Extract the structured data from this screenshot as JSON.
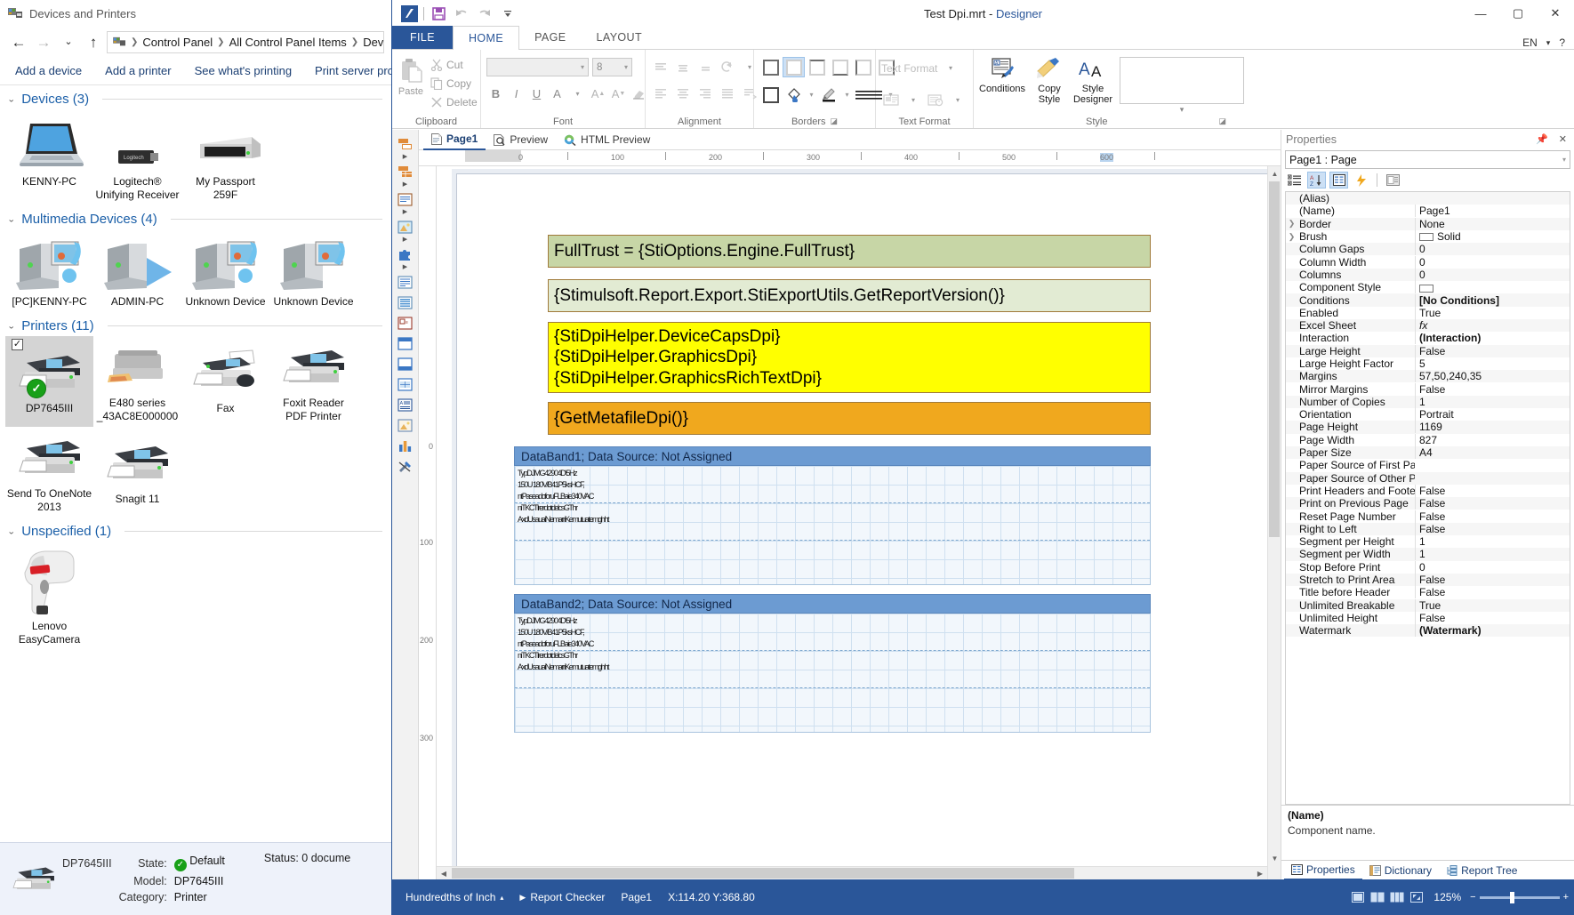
{
  "explorer": {
    "window_title": "Devices and Printers",
    "nav": {
      "back": "back-arrow",
      "forward": "forward-arrow",
      "recent": "chevron-down",
      "up": "up-arrow"
    },
    "breadcrumb": [
      "Control Panel",
      "All Control Panel Items",
      "Devices and Printers"
    ],
    "breadcrumb_visible_last": "Devices an",
    "commands": [
      "Add a device",
      "Add a printer",
      "See what's printing",
      "Print server prope"
    ],
    "groups": [
      {
        "title": "Devices (3)",
        "items": [
          {
            "label": "KENNY-PC",
            "icon": "laptop-icon"
          },
          {
            "label": "Logitech® Unifying Receiver",
            "icon": "usb-receiver-icon"
          },
          {
            "label": "My Passport 259F",
            "icon": "external-drive-icon"
          }
        ]
      },
      {
        "title": "Multimedia Devices (4)",
        "items": [
          {
            "label": "[PC]KENNY-PC",
            "icon": "media-device-icon"
          },
          {
            "label": "ADMIN-PC",
            "icon": "media-player-icon"
          },
          {
            "label": "Unknown Device",
            "icon": "media-device-icon"
          },
          {
            "label": "Unknown Device",
            "icon": "media-device-icon"
          }
        ]
      },
      {
        "title": "Printers (11)",
        "items": [
          {
            "label": "DP7645III",
            "icon": "printer-icon",
            "selected": true,
            "default": true,
            "checked": true
          },
          {
            "label": "E480 series _43AC8E000000",
            "icon": "inkjet-printer-icon"
          },
          {
            "label": "Fax",
            "icon": "fax-icon"
          },
          {
            "label": "Foxit Reader PDF Printer",
            "icon": "printer-icon"
          },
          {
            "label": "Send To OneNote 2013",
            "icon": "printer-icon"
          },
          {
            "label": "Snagit 11",
            "icon": "printer-icon"
          }
        ]
      },
      {
        "title": "Unspecified (1)",
        "items": [
          {
            "label": "Lenovo EasyCamera",
            "icon": "barcode-scanner-icon"
          }
        ]
      }
    ],
    "details": {
      "name": "DP7645III",
      "rows": [
        {
          "key": "State:",
          "value": "Default",
          "badge": "check-badge"
        },
        {
          "key": "Model:",
          "value": "DP7645III"
        },
        {
          "key": "Category:",
          "value": "Printer"
        }
      ],
      "status_key": "Status:",
      "status_value": "0 docume"
    }
  },
  "designer": {
    "title_file": "Test Dpi.mrt",
    "title_sep": "-",
    "title_app": "Designer",
    "quick_access": [
      "app-logo-icon",
      "save-icon",
      "undo-icon",
      "redo-icon",
      "customize-qat-icon"
    ],
    "window_buttons": [
      "minimize",
      "maximize",
      "close"
    ],
    "language": "EN",
    "tabs": [
      {
        "label": "FILE",
        "type": "file"
      },
      {
        "label": "HOME",
        "active": true
      },
      {
        "label": "PAGE"
      },
      {
        "label": "LAYOUT"
      }
    ],
    "ribbon": {
      "clipboard": {
        "label": "Clipboard",
        "paste": "Paste",
        "items": [
          "Cut",
          "Copy",
          "Delete"
        ]
      },
      "font": {
        "label": "Font",
        "font_name": "",
        "font_size": "8",
        "buttons": [
          "B",
          "I",
          "U",
          "A",
          "A-grow",
          "A-shrink",
          "clear-format"
        ]
      },
      "alignment": {
        "label": "Alignment",
        "buttons": [
          "align-top",
          "align-middle",
          "align-bottom",
          "text-rotation",
          "align-left",
          "align-center",
          "align-right",
          "align-justify",
          "text-wrap"
        ]
      },
      "borders": {
        "label": "Borders",
        "presets": [
          "all-borders",
          "no-border",
          "top-border",
          "bottom-border",
          "left-border",
          "right-border",
          "outline-border"
        ],
        "selected_index": 1,
        "fill": "fill-color-icon",
        "pen": "border-color-icon",
        "style": "border-style-icon"
      },
      "text_format": {
        "label": "Text Format",
        "combo_value": "Text Format",
        "buttons": [
          "format-image",
          "format-datetime"
        ]
      },
      "style": {
        "label": "Style",
        "conditions": "Conditions",
        "copy_style": "Copy\nStyle",
        "copy_style_l1": "Copy",
        "copy_style_l2": "Style",
        "style_designer_l1": "Style",
        "style_designer_l2": "Designer"
      }
    },
    "page_tabs": [
      {
        "label": "Page1",
        "icon": "page-icon",
        "active": true
      },
      {
        "label": "Preview",
        "icon": "preview-icon"
      },
      {
        "label": "HTML Preview",
        "icon": "html-preview-icon"
      }
    ],
    "ruler_h_ticks": [
      "0",
      "100",
      "200",
      "300",
      "400",
      "500",
      "600"
    ],
    "ruler_v_ticks": [
      "0",
      "100",
      "200",
      "300"
    ],
    "report": {
      "text1": "FullTrust = {StiOptions.Engine.FullTrust}",
      "text2": "{Stimulsoft.Report.Export.StiExportUtils.GetReportVersion()}",
      "text3_lines": [
        "{StiDpiHelper.DeviceCapsDpi}",
        "{StiDpiHelper.GraphicsDpi}",
        "{StiDpiHelper.GraphicsRichTextDpi}"
      ],
      "text4": "{GetMetafileDpi()}",
      "band1_header": "DataBand1; Data Source: Not Assigned",
      "band2_header": "DataBand2; Data Source: Not Assigned",
      "band_overlap_lines": [
        "TypDJMG42904D\\5Hz",
        "150U 180V/B41P5ksHCF,",
        "ntPaseadoforuFLBaie340VAC",
        "niTKCTlrerdotdelcsGThr",
        "AxdUsauaiNemarriKemutuatemghht"
      ]
    },
    "properties": {
      "pane_title": "Properties",
      "pin_icon": "pin-icon",
      "close_icon": "close-icon",
      "selected_object": "Page1 : Page",
      "toolbar": [
        "categorized-icon",
        "alphabetical-icon",
        "properties-icon",
        "events-icon",
        "property-pages-icon"
      ],
      "columns": [
        "Name",
        "Value"
      ],
      "rows": [
        {
          "name": "(Alias)",
          "value": "",
          "expandable": false
        },
        {
          "name": "(Name)",
          "value": "Page1",
          "expandable": false
        },
        {
          "name": "Border",
          "value": "None",
          "expandable": true
        },
        {
          "name": "Brush",
          "value": "Solid",
          "expandable": true,
          "swatch": "#ffffff"
        },
        {
          "name": "Column Gaps",
          "value": "0"
        },
        {
          "name": "Column Width",
          "value": "0"
        },
        {
          "name": "Columns",
          "value": "0"
        },
        {
          "name": "Component Style",
          "value": "",
          "swatch": "#ffffff"
        },
        {
          "name": "Conditions",
          "value": "[No Conditions]"
        },
        {
          "name": "Enabled",
          "value": "True"
        },
        {
          "name": "Excel Sheet",
          "value": "fx",
          "italic": true
        },
        {
          "name": "Interaction",
          "value": "(Interaction)"
        },
        {
          "name": "Large Height",
          "value": "False"
        },
        {
          "name": "Large Height Factor",
          "value": "5"
        },
        {
          "name": "Margins",
          "value": "57,50,240,35"
        },
        {
          "name": "Mirror Margins",
          "value": "False"
        },
        {
          "name": "Number of Copies",
          "value": "1"
        },
        {
          "name": "Orientation",
          "value": "Portrait"
        },
        {
          "name": "Page Height",
          "value": "1169"
        },
        {
          "name": "Page Width",
          "value": "827"
        },
        {
          "name": "Paper Size",
          "value": "A4"
        },
        {
          "name": "Paper Source of First Page",
          "value": ""
        },
        {
          "name": "Paper Source of Other Pag",
          "value": ""
        },
        {
          "name": "Print Headers and Footers",
          "value": "False"
        },
        {
          "name": "Print on Previous Page",
          "value": "False"
        },
        {
          "name": "Reset Page Number",
          "value": "False"
        },
        {
          "name": "Right to Left",
          "value": "False"
        },
        {
          "name": "Segment per Height",
          "value": "1"
        },
        {
          "name": "Segment per Width",
          "value": "1"
        },
        {
          "name": "Stop Before Print",
          "value": "0"
        },
        {
          "name": "Stretch to Print Area",
          "value": "False"
        },
        {
          "name": "Title before Header",
          "value": "False"
        },
        {
          "name": "Unlimited Breakable",
          "value": "True"
        },
        {
          "name": "Unlimited Height",
          "value": "False"
        },
        {
          "name": "Watermark",
          "value": "(Watermark)"
        }
      ],
      "desc_title": "(Name)",
      "desc_text": "Component name.",
      "bottom_tabs": [
        {
          "label": "Properties",
          "icon": "properties-icon",
          "active": true
        },
        {
          "label": "Dictionary",
          "icon": "dictionary-icon"
        },
        {
          "label": "Report Tree",
          "icon": "report-tree-icon"
        }
      ]
    },
    "status_bar": {
      "units": "Hundredths of Inch",
      "report_checker": "Report Checker",
      "page": "Page1",
      "coords": "X:114.20  Y:368.80",
      "zoom": "125%"
    }
  }
}
